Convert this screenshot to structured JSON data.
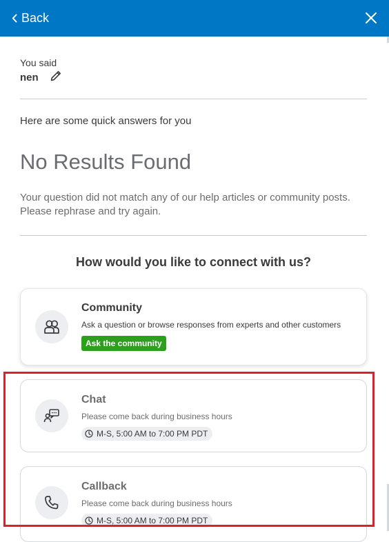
{
  "header": {
    "back_label": "Back"
  },
  "query": {
    "label": "You said",
    "value": "nen"
  },
  "results": {
    "intro": "Here are some quick answers for you",
    "title": "No Results Found",
    "description": "Your question did not match any of our help articles or community posts. Please rephrase and try again."
  },
  "connect": {
    "heading": "How would you like to connect with us?",
    "options": [
      {
        "title": "Community",
        "description": "Ask a question or browse responses from experts and other customers",
        "action": "Ask the community",
        "icon": "community-icon"
      },
      {
        "title": "Chat",
        "description": "Please come back during business hours",
        "hours": "M-S, 5:00 AM to 7:00 PM PDT",
        "icon": "chat-icon"
      },
      {
        "title": "Callback",
        "description": "Please come back during business hours",
        "hours": "M-S, 5:00 AM to 7:00 PM PDT",
        "icon": "phone-icon"
      }
    ]
  },
  "colors": {
    "header": "#0077c5",
    "action": "#2ca01c",
    "highlight": "#e21f26"
  }
}
